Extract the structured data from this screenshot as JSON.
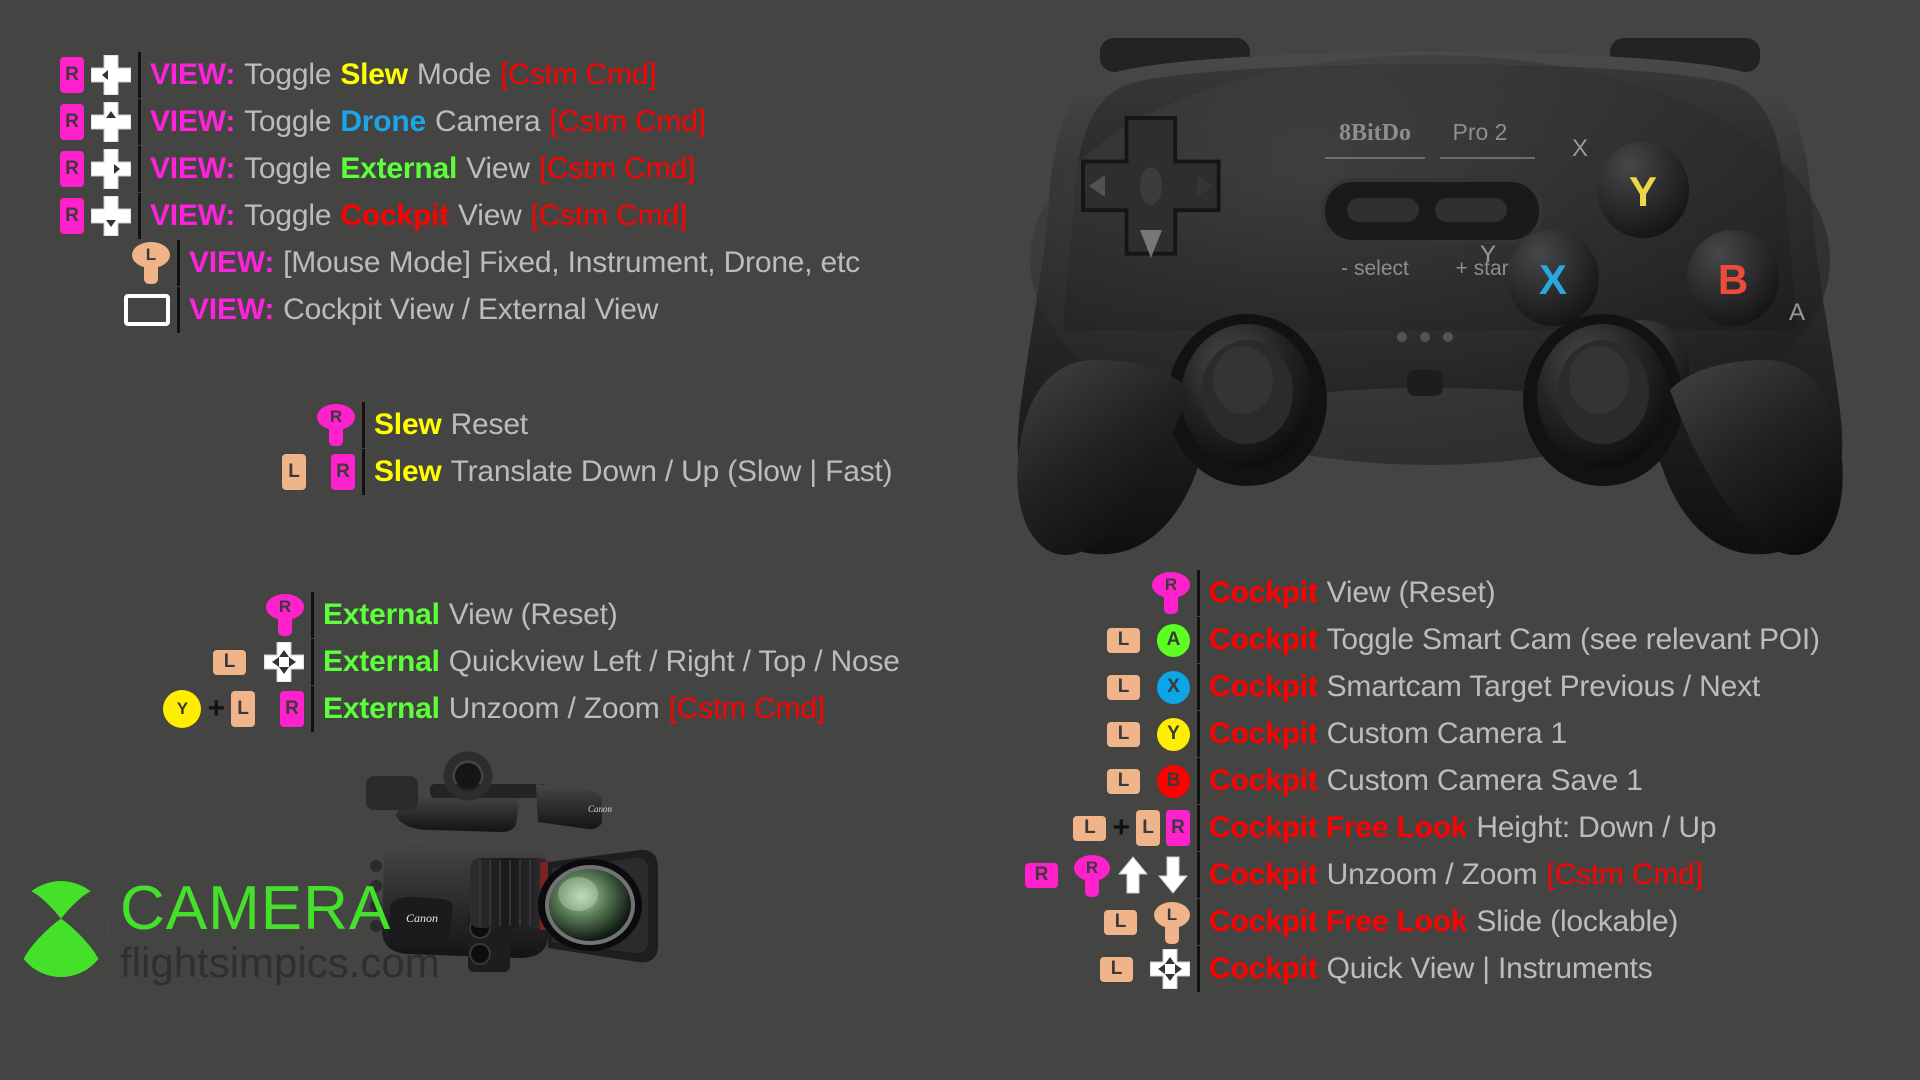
{
  "meta": {
    "background_color": "#444443",
    "accent_magenta": "#ff22dd",
    "accent_green": "#5dff3a",
    "accent_red": "#ff0000",
    "accent_yellow": "#ffff00",
    "accent_blue": "#19a6e8",
    "text_grey": "#b9bcc0"
  },
  "view_section": {
    "rows": [
      {
        "prefix": "VIEW:",
        "parts": [
          {
            "t": "Toggle",
            "c": "grey"
          },
          {
            "t": "Slew",
            "c": "yellow"
          },
          {
            "t": "Mode",
            "c": "grey"
          },
          {
            "t": "[Cstm Cmd]",
            "c": "red-n"
          }
        ]
      },
      {
        "prefix": "VIEW:",
        "parts": [
          {
            "t": "Toggle",
            "c": "grey"
          },
          {
            "t": "Drone",
            "c": "blue"
          },
          {
            "t": "Camera",
            "c": "grey"
          },
          {
            "t": "[Cstm Cmd]",
            "c": "red-n"
          }
        ]
      },
      {
        "prefix": "VIEW:",
        "parts": [
          {
            "t": "Toggle",
            "c": "grey"
          },
          {
            "t": "External",
            "c": "green"
          },
          {
            "t": "View",
            "c": "grey"
          },
          {
            "t": "[Cstm Cmd]",
            "c": "red-n"
          }
        ]
      },
      {
        "prefix": "VIEW:",
        "parts": [
          {
            "t": "Toggle",
            "c": "grey"
          },
          {
            "t": "Cockpit",
            "c": "red"
          },
          {
            "t": "View",
            "c": "grey"
          },
          {
            "t": "[Cstm Cmd]",
            "c": "red-n"
          }
        ]
      },
      {
        "prefix": "VIEW:",
        "parts": [
          {
            "t": "[Mouse Mode] Fixed, Instrument, Drone, etc",
            "c": "grey"
          }
        ]
      },
      {
        "prefix": "VIEW:",
        "parts": [
          {
            "t": "Cockpit View / External View",
            "c": "grey"
          }
        ]
      }
    ],
    "button_labels": {
      "r_shoulder": "R",
      "l_stick": "L"
    }
  },
  "slew_section": {
    "rows": [
      {
        "parts": [
          {
            "t": "Slew",
            "c": "yellow"
          },
          {
            "t": "Reset",
            "c": "grey"
          }
        ]
      },
      {
        "parts": [
          {
            "t": "Slew",
            "c": "yellow"
          },
          {
            "t": "Translate Down / Up (Slow | Fast)",
            "c": "grey"
          }
        ]
      }
    ],
    "button_labels": {
      "r_stick": "R",
      "l_trigger": "L",
      "r_trigger": "R"
    }
  },
  "external_section": {
    "rows": [
      {
        "parts": [
          {
            "t": "External",
            "c": "green"
          },
          {
            "t": "View (Reset)",
            "c": "grey"
          }
        ]
      },
      {
        "parts": [
          {
            "t": "External",
            "c": "green"
          },
          {
            "t": "Quickview Left / Right / Top / Nose",
            "c": "grey"
          }
        ]
      },
      {
        "parts": [
          {
            "t": "External",
            "c": "green"
          },
          {
            "t": "Unzoom / Zoom",
            "c": "grey"
          },
          {
            "t": "[Cstm Cmd]",
            "c": "red-n"
          }
        ]
      }
    ],
    "button_labels": {
      "r_stick": "R",
      "l_trigger": "L",
      "r_trigger": "R",
      "y_face": "Y",
      "plus": "+"
    }
  },
  "cockpit_section": {
    "rows": [
      {
        "parts": [
          {
            "t": "Cockpit",
            "c": "red"
          },
          {
            "t": "View (Reset)",
            "c": "grey"
          }
        ]
      },
      {
        "parts": [
          {
            "t": "Cockpit",
            "c": "red"
          },
          {
            "t": "Toggle Smart Cam (see relevant POI)",
            "c": "grey"
          }
        ]
      },
      {
        "parts": [
          {
            "t": "Cockpit",
            "c": "red"
          },
          {
            "t": "Smartcam Target Previous / Next",
            "c": "grey"
          }
        ]
      },
      {
        "parts": [
          {
            "t": "Cockpit",
            "c": "red"
          },
          {
            "t": "Custom Camera 1",
            "c": "grey"
          }
        ]
      },
      {
        "parts": [
          {
            "t": "Cockpit",
            "c": "red"
          },
          {
            "t": "Custom Camera Save 1",
            "c": "grey"
          }
        ]
      },
      {
        "parts": [
          {
            "t": "Cockpit Free Look",
            "c": "red"
          },
          {
            "t": "Height: Down / Up",
            "c": "grey"
          }
        ]
      },
      {
        "parts": [
          {
            "t": "Cockpit",
            "c": "red"
          },
          {
            "t": "Unzoom / Zoom",
            "c": "grey"
          },
          {
            "t": "[Cstm Cmd]",
            "c": "red-n"
          }
        ]
      },
      {
        "parts": [
          {
            "t": "Cockpit Free Look",
            "c": "red"
          },
          {
            "t": "Slide (lockable)",
            "c": "grey"
          }
        ]
      },
      {
        "parts": [
          {
            "t": "Cockpit",
            "c": "red"
          },
          {
            "t": "Quick View | Instruments",
            "c": "grey"
          }
        ]
      }
    ],
    "button_labels": {
      "r_stick": "R",
      "l_shoulder": "L",
      "a_face": "A",
      "x_face": "X",
      "y_face": "Y",
      "b_face": "B",
      "l_trigger": "L",
      "r_trigger": "R",
      "r_shoulder": "R",
      "plus": "+"
    }
  },
  "controller": {
    "brand": "8BitDo",
    "model": "Pro 2",
    "select_label": "- select",
    "start_label": "+ start",
    "face_buttons": [
      {
        "main": "Y",
        "main_color": "#e8d84a",
        "secondary": "X"
      },
      {
        "main": "X",
        "main_color": "#29a8e0",
        "secondary": "Y"
      },
      {
        "main": "B",
        "main_color": "#ee4b3a",
        "secondary": "A"
      },
      {
        "main": "A",
        "main_color": "#7ed321",
        "secondary": "B"
      }
    ]
  },
  "branding": {
    "title": "CAMERA",
    "website": "flightsimpics.com",
    "camera_brand": "Canon"
  }
}
